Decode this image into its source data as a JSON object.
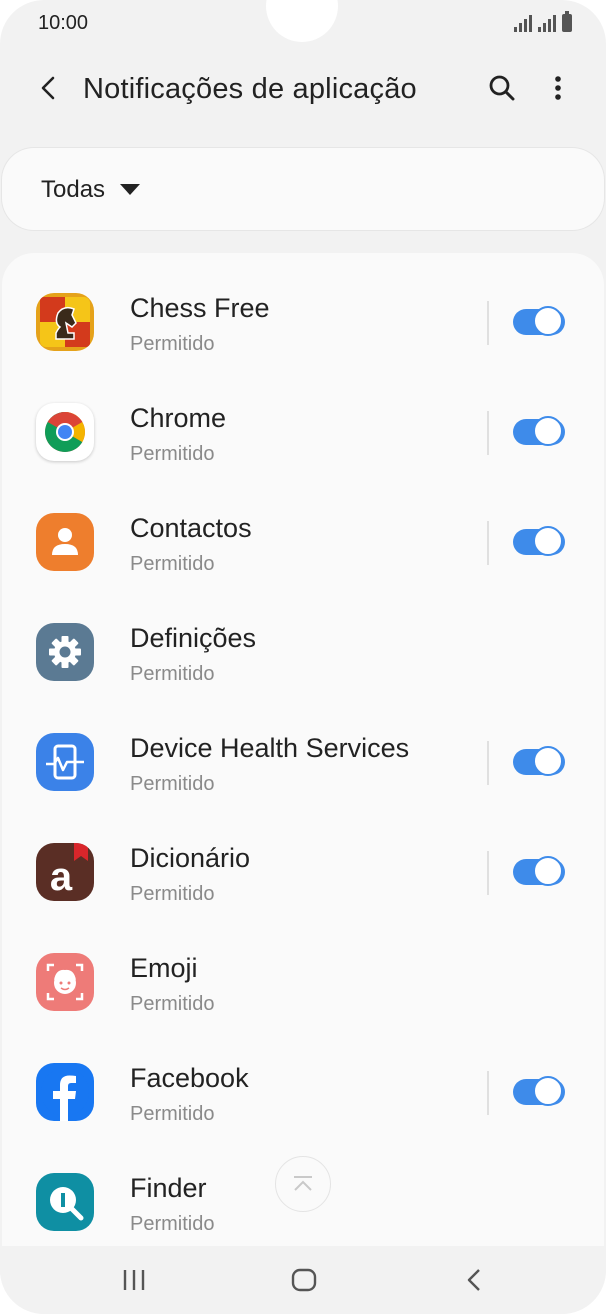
{
  "status_bar": {
    "time": "10:00"
  },
  "header": {
    "title": "Notificações de aplicação"
  },
  "filter": {
    "label": "Todas"
  },
  "apps": [
    {
      "name": "Chess Free",
      "status": "Permitido",
      "toggle_on": true
    },
    {
      "name": "Chrome",
      "status": "Permitido",
      "toggle_on": true
    },
    {
      "name": "Contactos",
      "status": "Permitido",
      "toggle_on": true
    },
    {
      "name": "Definições",
      "status": "Permitido",
      "toggle_on": false
    },
    {
      "name": "Device Health Services",
      "status": "Permitido",
      "toggle_on": true
    },
    {
      "name": "Dicionário",
      "status": "Permitido",
      "toggle_on": true
    },
    {
      "name": "Emoji",
      "status": "Permitido",
      "toggle_on": false
    },
    {
      "name": "Facebook",
      "status": "Permitido",
      "toggle_on": true
    },
    {
      "name": "Finder",
      "status": "Permitido",
      "toggle_on": false
    }
  ],
  "icons": {
    "back": "back-arrow-icon",
    "search": "search-icon",
    "more": "more-vert-icon",
    "scroll_top": "scroll-to-top-icon",
    "nav_recents": "recents-icon",
    "nav_home": "home-icon",
    "nav_back": "nav-back-icon"
  },
  "colors": {
    "accent": "#3e8bea"
  }
}
